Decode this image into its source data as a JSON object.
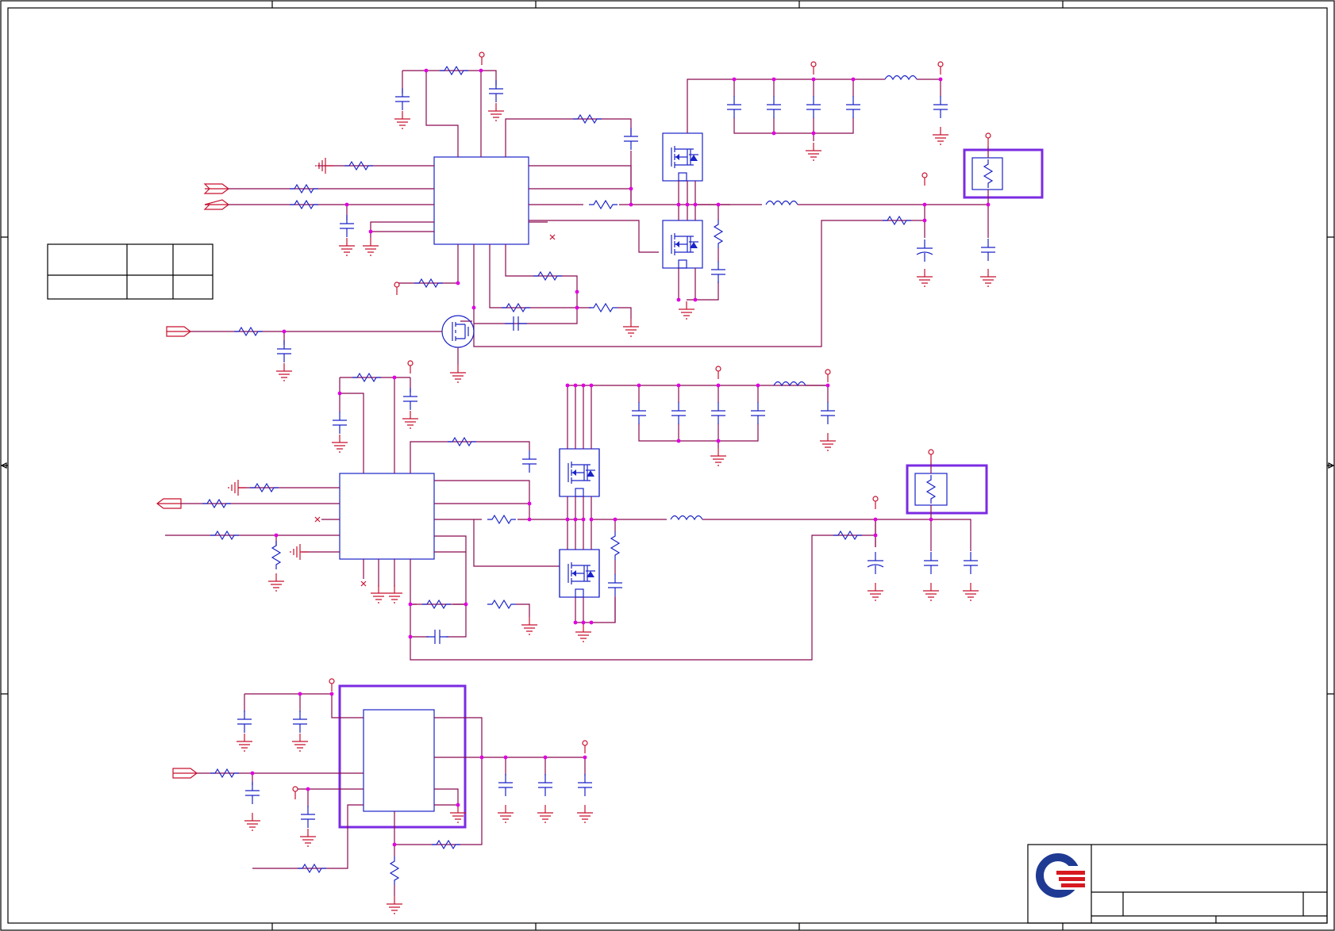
{
  "sheet": {
    "frame_color": "#000000",
    "wire_color": "#c8102e",
    "net_color": "#8b0a50",
    "component_color": "#1a23c8",
    "junction_color": "#e000e0",
    "highlight_color": "#7b2be2"
  },
  "title_block": {
    "logo": "company-logo",
    "title": "",
    "doc_number": "",
    "sheet_label": ""
  },
  "blocks": [
    {
      "id": "converter-1",
      "controller": "pwm-controller",
      "mosfets": 2,
      "inductors": 2
    },
    {
      "id": "converter-2",
      "controller": "pwm-controller",
      "mosfets": 2,
      "inductors": 2
    },
    {
      "id": "regulator-3",
      "controller": "linear-regulator"
    }
  ],
  "highlights": 3
}
